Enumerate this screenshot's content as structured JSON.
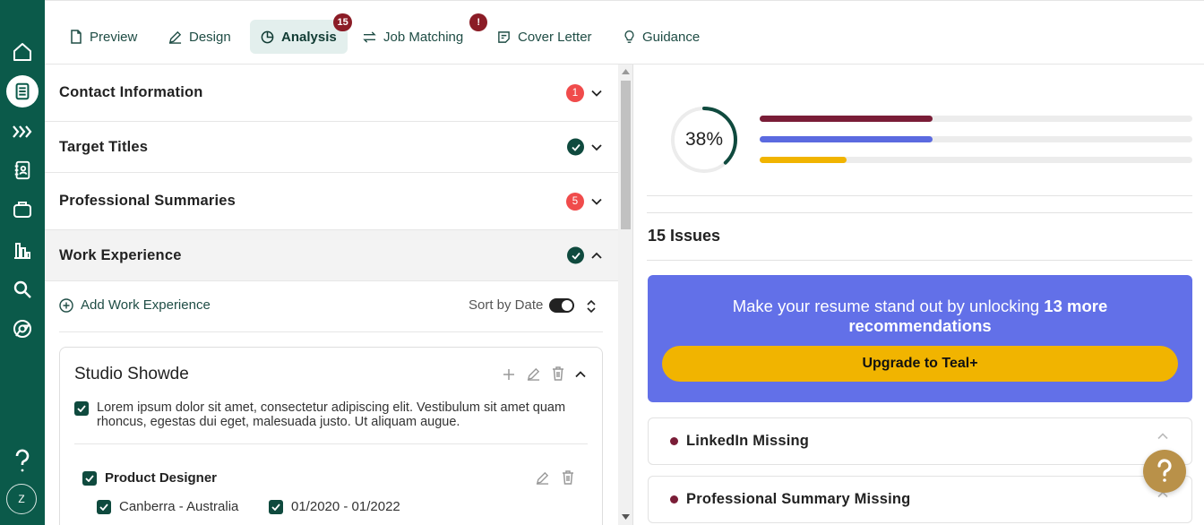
{
  "tabs": [
    {
      "label": "Preview",
      "icon": "file-icon"
    },
    {
      "label": "Design",
      "icon": "pen-icon"
    },
    {
      "label": "Analysis",
      "icon": "pie-chart-icon",
      "badge": "15"
    },
    {
      "label": "Job Matching",
      "icon": "arrows-swap-icon",
      "badge": "!"
    },
    {
      "label": "Cover Letter",
      "icon": "sticky-note-icon"
    },
    {
      "label": "Guidance",
      "icon": "lightbulb-icon"
    }
  ],
  "sections": [
    {
      "title": "Contact Information",
      "count": "1"
    },
    {
      "title": "Target Titles"
    },
    {
      "title": "Professional Summaries",
      "count": "5"
    },
    {
      "title": "Work Experience"
    }
  ],
  "work": {
    "add_label": "Add Work Experience",
    "sort_label": "Sort by Date",
    "company": "Studio Showde",
    "description": "Lorem ipsum dolor sit amet, consectetur adipiscing elit. Vestibulum sit amet quam rhoncus, egestas dui eget, malesuada justo. Ut aliquam augue.",
    "role": "Product Designer",
    "location": "Canberra - Australia",
    "dates": "01/2020 - 01/2022"
  },
  "analysis": {
    "score_label": "38%",
    "score": 0.38,
    "bars": [
      {
        "fill": 0.4,
        "color": "#7a1d37"
      },
      {
        "fill": 0.4,
        "color": "#5b6ae0"
      },
      {
        "fill": 0.2,
        "color": "#f1b400"
      }
    ],
    "issues_heading": "15 Issues",
    "promo_text": "Make your resume stand out by unlocking",
    "promo_bold": "13 more recommendations",
    "promo_button": "Upgrade to Teal+",
    "issues": [
      "LinkedIn Missing",
      "Professional Summary Missing"
    ]
  },
  "user": {
    "initial": "Z"
  },
  "colors": {
    "brand": "#0b5a4a",
    "accent": "#6270e8",
    "cta": "#f1b400",
    "alert": "#f04b4b"
  }
}
